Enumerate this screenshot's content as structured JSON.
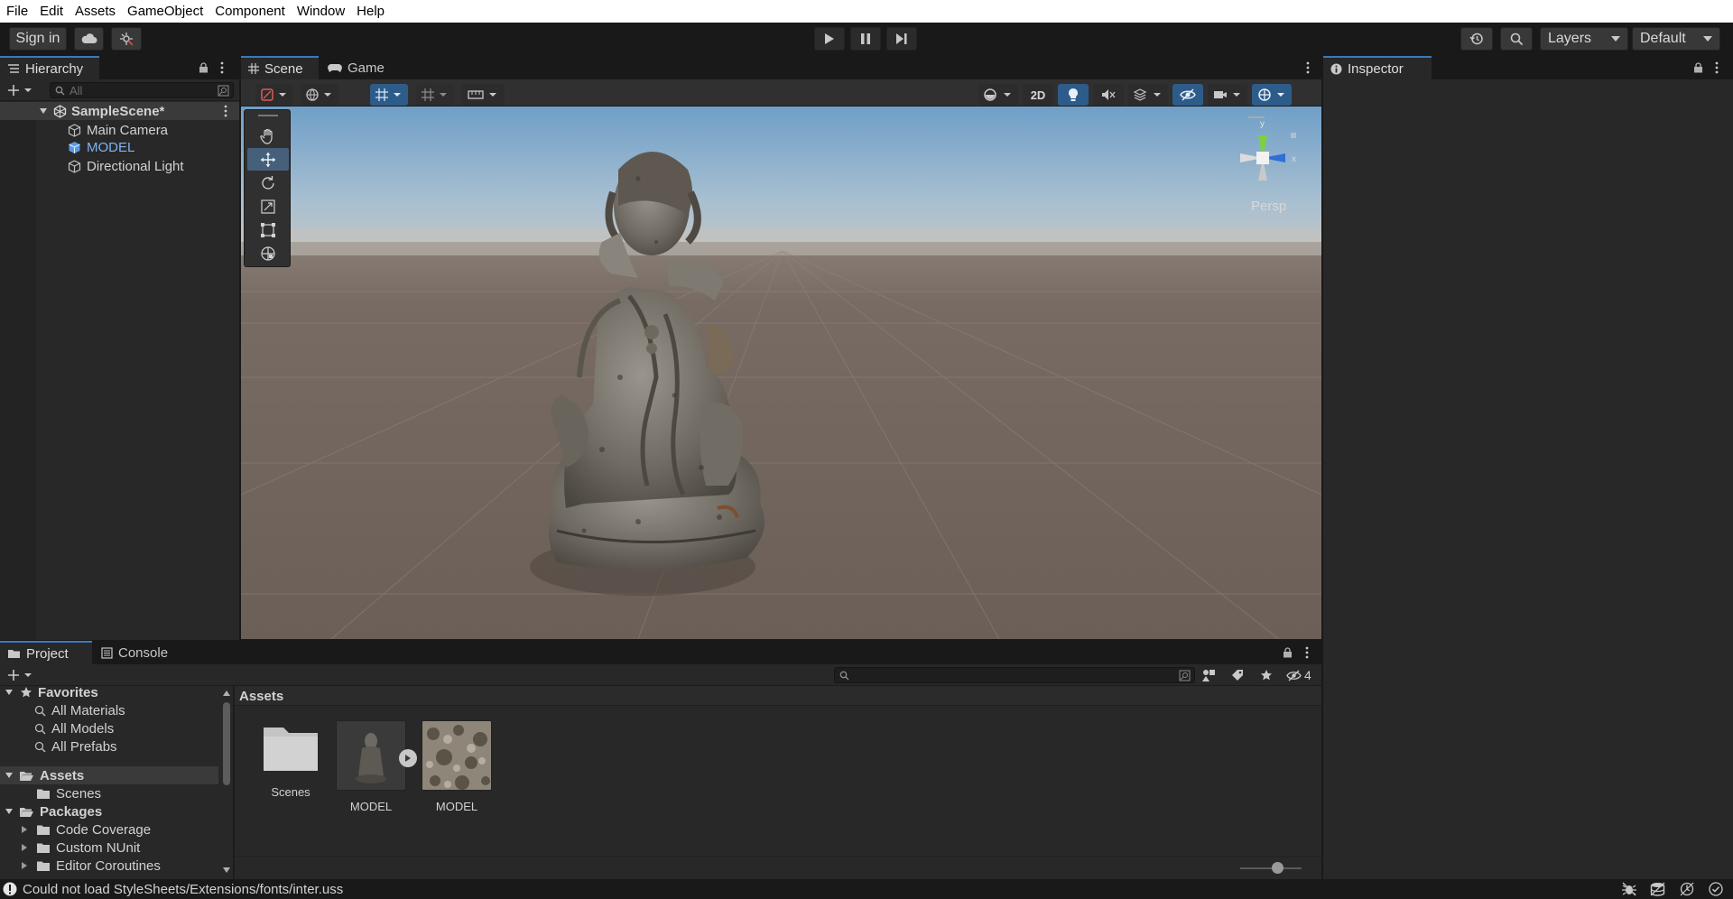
{
  "menu": [
    "File",
    "Edit",
    "Assets",
    "GameObject",
    "Component",
    "Window",
    "Help"
  ],
  "toolbar": {
    "sign_in": "Sign in",
    "layers": "Layers",
    "layout": "Default"
  },
  "scene_tabs": [
    "Scene",
    "Game"
  ],
  "hierarchy": {
    "tab": "Hierarchy",
    "search_placeholder": "All",
    "scene_name": "SampleScene*",
    "items": [
      "Main Camera",
      "MODEL",
      "Directional Light"
    ]
  },
  "scene_view": {
    "toggle_2d": "2D",
    "projection": "Persp",
    "gizmo_y": "y",
    "gizmo_x": "x",
    "tools": [
      "hand-tool",
      "move-tool",
      "rotate-tool",
      "scale-tool",
      "rect-tool",
      "transform-tool"
    ],
    "active_tool": "move-tool"
  },
  "inspector": {
    "tab": "Inspector"
  },
  "project": {
    "tabs": [
      "Project",
      "Console"
    ],
    "favorites_label": "Favorites",
    "favorites": [
      "All Materials",
      "All Models",
      "All Prefabs"
    ],
    "assets_label": "Assets",
    "assets_children": [
      "Scenes"
    ],
    "packages_label": "Packages",
    "packages": [
      "Code Coverage",
      "Custom NUnit",
      "Editor Coroutines"
    ],
    "breadcrumb": "Assets",
    "hidden_count": "4",
    "grid_items": [
      {
        "label": "Scenes",
        "kind": "folder"
      },
      {
        "label": "MODEL",
        "kind": "model"
      },
      {
        "label": "MODEL",
        "kind": "texture"
      }
    ]
  },
  "status": {
    "message": "Could not load StyleSheets/Extensions/fonts/inter.uss"
  },
  "colors": {
    "accent": "#3a79bb",
    "selection": "#2c5d87",
    "model_label": "#7eb2f1",
    "panel_bg": "#282828",
    "chrome_bg": "#191919"
  }
}
